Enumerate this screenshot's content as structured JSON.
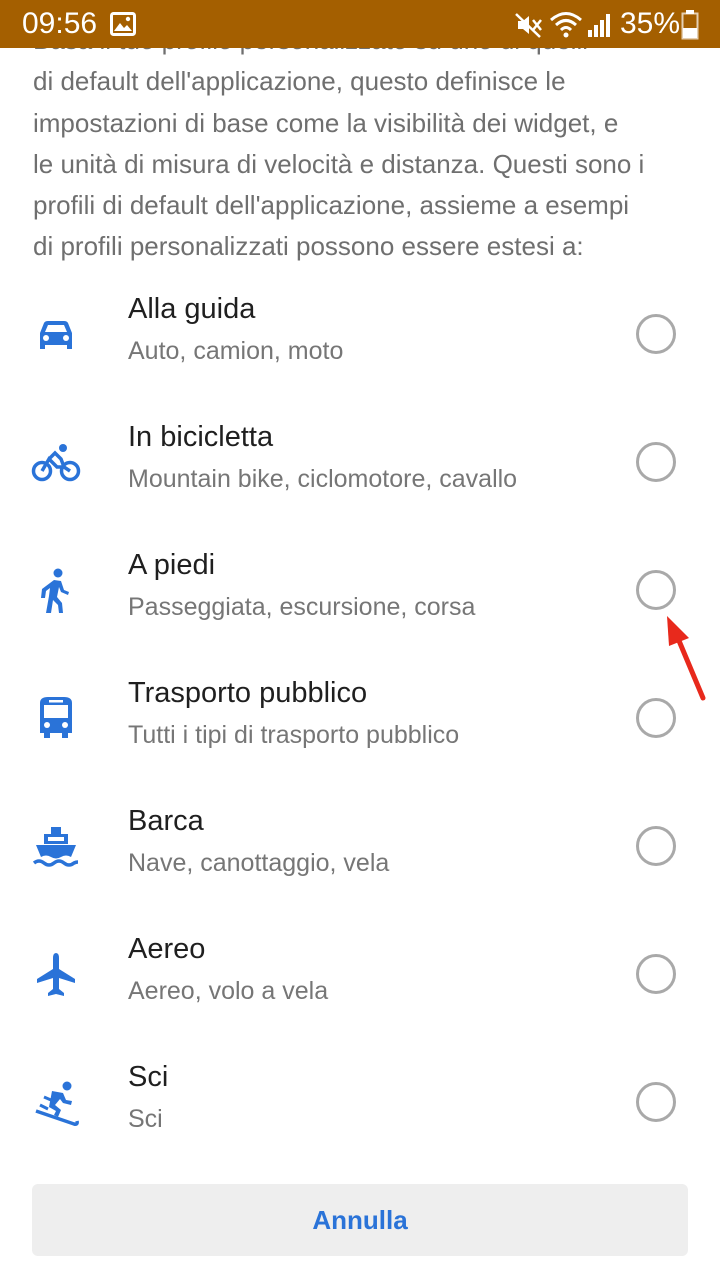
{
  "status_bar": {
    "time": "09:56",
    "battery": "35%",
    "icons": [
      "gallery-icon",
      "mute-icon",
      "wifi-icon",
      "signal-icon",
      "battery-icon"
    ],
    "color": "#a45f00"
  },
  "intro": {
    "lines": [
      "Basa il tuo profilo personalizzato su uno di quelli",
      "di default dell'applicazione, questo definisce le",
      "impostazioni di base come la visibilità dei widget, e",
      "le unità di misura di velocità e distanza. Questi sono i",
      "profili di default dell'applicazione, assieme a esempi",
      "di profili personalizzati possono essere estesi a:"
    ]
  },
  "accent_color": "#2a73d8",
  "options": [
    {
      "title": "Alla guida",
      "subtitle": "Auto, camion, moto",
      "icon": "car-icon"
    },
    {
      "title": "In bicicletta",
      "subtitle": "Mountain bike, ciclomotore, cavallo",
      "icon": "bicycle-icon"
    },
    {
      "title": "A piedi",
      "subtitle": "Passeggiata, escursione, corsa",
      "icon": "walking-icon"
    },
    {
      "title": "Trasporto pubblico",
      "subtitle": "Tutti i tipi di trasporto pubblico",
      "icon": "bus-icon"
    },
    {
      "title": "Barca",
      "subtitle": "Nave, canottaggio, vela",
      "icon": "boat-icon"
    },
    {
      "title": "Aereo",
      "subtitle": "Aereo, volo a vela",
      "icon": "airplane-icon"
    },
    {
      "title": "Sci",
      "subtitle": "Sci",
      "icon": "skiing-icon"
    }
  ],
  "cancel_button": {
    "label": "Annulla"
  }
}
